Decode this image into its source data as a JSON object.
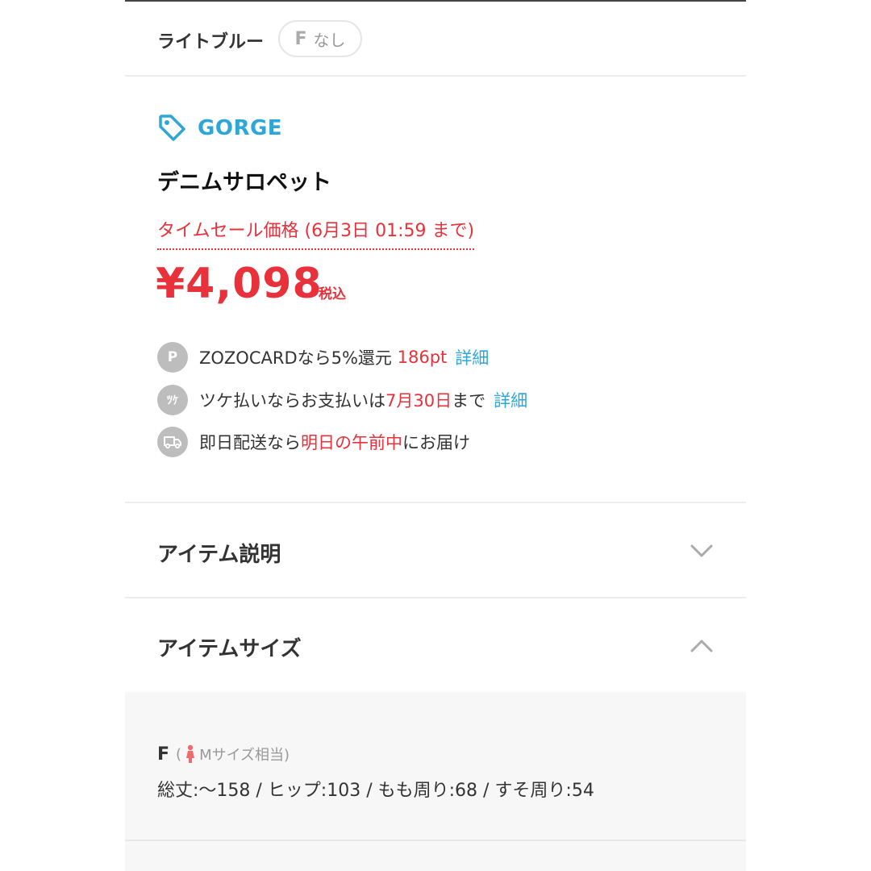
{
  "color": {
    "name": "ライトブルー",
    "size_label": "F",
    "stock_label": "なし"
  },
  "brand": {
    "icon": "tag-icon",
    "name": "GORGE",
    "color": "#2ea7d8"
  },
  "item": {
    "name": "デニムサロペット"
  },
  "price": {
    "sale_label": "タイムセール価格 (6月3日 01:59 まで)",
    "amount": "¥4,098",
    "tax_label": "税込",
    "color": "#e8313b"
  },
  "perks": [
    {
      "icon": "points-icon",
      "icon_text": "P",
      "pre": "ZOZOCARDなら5%還元 ",
      "highlight": "186pt",
      "post": "",
      "link": "詳細"
    },
    {
      "icon": "tsuke-payment-icon",
      "icon_text": "ﾂｹ",
      "pre": "ツケ払いならお支払いは",
      "highlight": "7月30日",
      "post": "まで",
      "link": "詳細"
    },
    {
      "icon": "delivery-truck-icon",
      "icon_text": "",
      "pre": "即日配送なら",
      "highlight": "明日の午前中",
      "post": "にお届け",
      "link": ""
    }
  ],
  "sections": {
    "description": {
      "title": "アイテム説明",
      "icon": "chevron-down-icon"
    },
    "size": {
      "title": "アイテムサイズ",
      "icon": "chevron-up-icon",
      "size_name": "F",
      "note_open": "(",
      "note_icon": "female-icon",
      "note_text": "Mサイズ相当)",
      "dims": "総丈:〜158 / ヒップ:103 / もも周り:68 / すそ周り:54"
    }
  }
}
